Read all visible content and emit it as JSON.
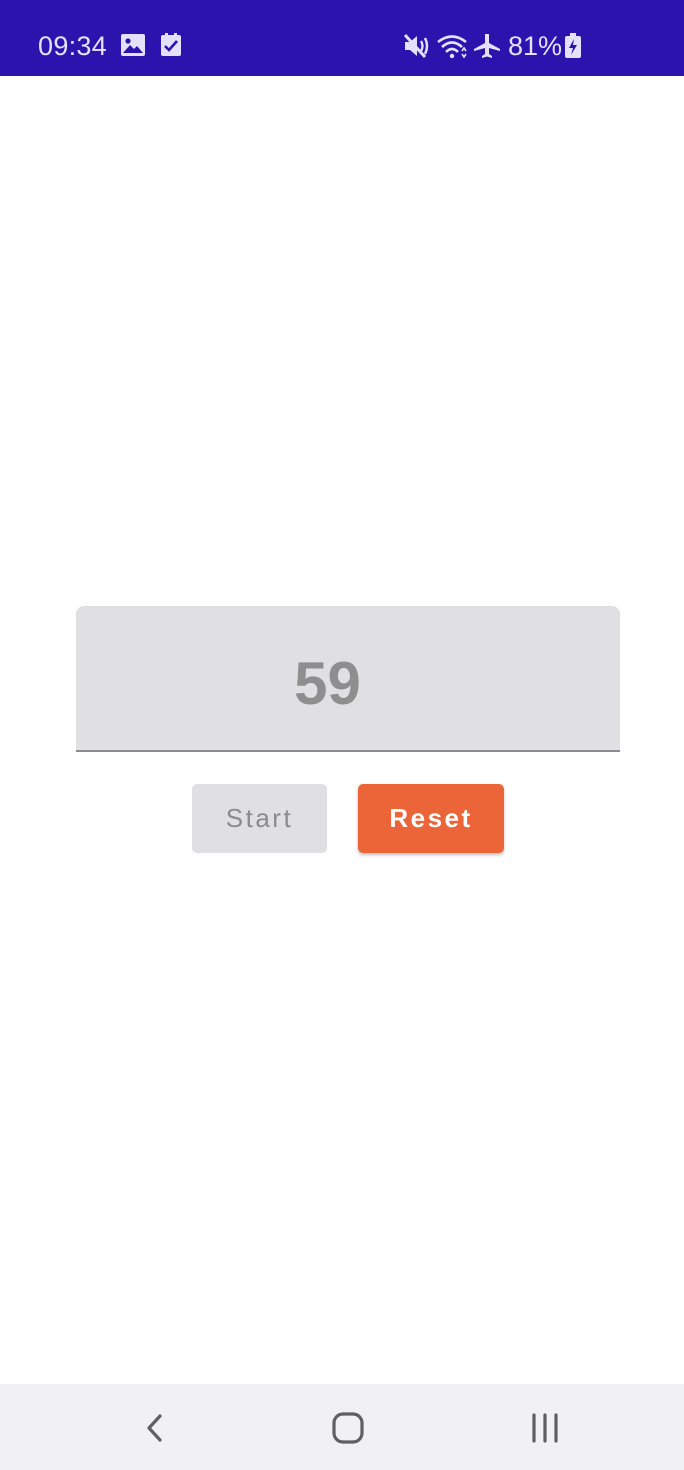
{
  "status_bar": {
    "time": "09:34",
    "battery_percent": "81%",
    "background_color": "#2d13ad",
    "icons": [
      "image-notification-icon",
      "task-check-icon",
      "mute-icon",
      "wifi-icon",
      "airplane-mode-icon",
      "battery-charging-icon"
    ]
  },
  "counter": {
    "value": "59"
  },
  "buttons": {
    "start_label": "Start",
    "reset_label": "Reset",
    "start_state": "disabled",
    "reset_color": "#ec6538"
  },
  "nav_bar": {
    "icons": [
      "back-icon",
      "home-icon",
      "recent-apps-icon"
    ]
  }
}
